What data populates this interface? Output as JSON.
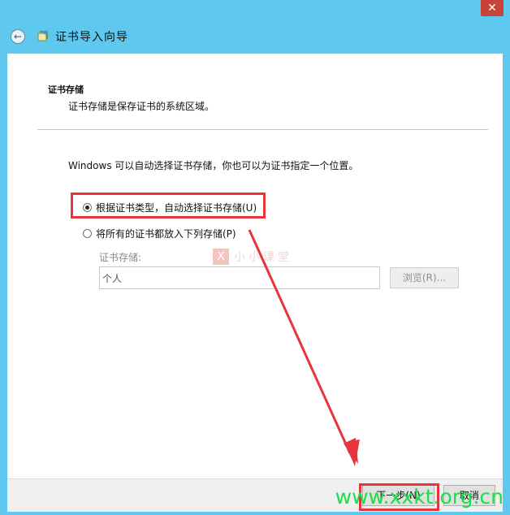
{
  "window": {
    "title": "证书导入向导",
    "close_label": "✕"
  },
  "header": {
    "title": "证书存储",
    "description": "证书存储是保存证书的系统区域。"
  },
  "body": {
    "intro": "Windows 可以自动选择证书存储，你也可以为证书指定一个位置。",
    "option_auto": "根据证书类型，自动选择证书存储(U)",
    "option_manual": "将所有的证书都放入下列存储(P)",
    "store_label": "证书存储:",
    "store_value": "个人",
    "browse_label": "浏览(R)..."
  },
  "footer": {
    "next_label": "下一步(N)",
    "cancel_label": "取消"
  },
  "watermarks": {
    "center_mark": "X",
    "center_text": "小小课堂",
    "site": "www.xxkt.org.cn"
  },
  "colors": {
    "accent": "#5ec8ef",
    "annotation_red": "#e8343b",
    "site_green": "#19e04a"
  },
  "icons": {
    "back": "back-arrow-icon",
    "wizard": "certificate-wizard-icon"
  }
}
